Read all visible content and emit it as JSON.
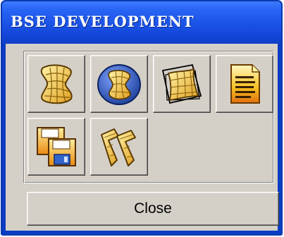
{
  "window": {
    "title": "BSE DEVELOPMENT"
  },
  "toolbar": {
    "buttons": [
      {
        "name": "surface-patch",
        "icon": "surface-patch-icon"
      },
      {
        "name": "surface-on-disk",
        "icon": "surface-on-disk-icon"
      },
      {
        "name": "surface-in-frame",
        "icon": "surface-in-frame-icon"
      },
      {
        "name": "document",
        "icon": "document-icon"
      },
      {
        "name": "save-files",
        "icon": "floppy-disk-icon"
      },
      {
        "name": "chevron-surfaces",
        "icon": "chevron-surfaces-icon"
      }
    ]
  },
  "footer": {
    "close_label": "Close"
  },
  "colors": {
    "titlebar": "#1a52e6",
    "client": "#d4d0c8",
    "icon_fill": "#f0c040",
    "disk_blue": "#3366cc"
  }
}
